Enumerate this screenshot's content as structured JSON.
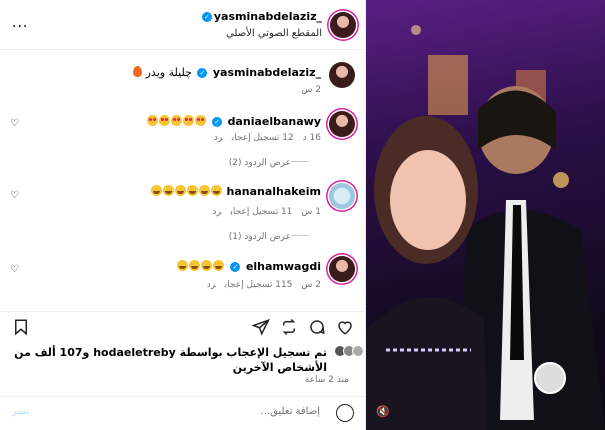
{
  "header": {
    "username": "yasminabdelaziz_",
    "audio_label": "المقطع الصوتي الأصلي",
    "more_label": "..."
  },
  "caption": {
    "username": "yasminabdelaziz_",
    "text": "چليلة ويدر",
    "time": "2 س"
  },
  "comments": [
    {
      "username": "daniaelbanawy",
      "emoji_count": 5,
      "emoji": "heart-eyes",
      "time": "16 د",
      "likes": "12 تسجيل إعجاب",
      "reply": "رد",
      "view_replies": "عرض الردود (2)"
    },
    {
      "username": "hananalhakeim",
      "emoji_count": 6,
      "emoji": "laughing",
      "time": "1 س",
      "likes": "11 تسجيل إعجاب",
      "reply": "رد",
      "view_replies": "عرض الردود (1)"
    },
    {
      "username": "elhamwagdi",
      "emoji_count": 4,
      "emoji": "laughing",
      "time": "2 س",
      "likes": "115 تسجيل إعجاب",
      "reply": "رد",
      "view_replies": ""
    }
  ],
  "likes_summary": "تم تسجيل الإعجاب بواسطة hodaeletreby و107 ألف من الأشخاص الآخرين",
  "post_time": "منذ 2 ساعة",
  "add_comment": {
    "placeholder": "إضافة تعليق...",
    "post_label": "نشر"
  },
  "colors": {
    "verified": "#0095f6",
    "link_faded": "#b2dffc",
    "meta": "#737373"
  }
}
